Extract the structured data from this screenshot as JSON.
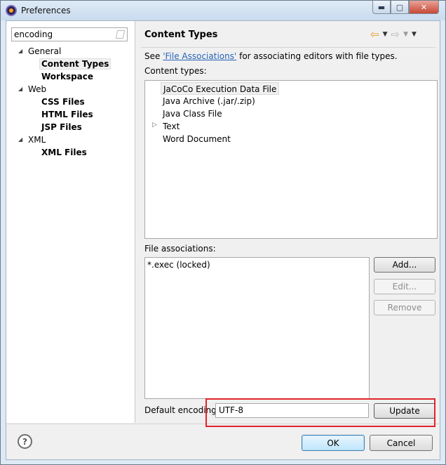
{
  "window": {
    "title": "Preferences",
    "minimize_glyph": "▬",
    "maximize_glyph": "▢",
    "close_glyph": "✕"
  },
  "filter": {
    "value": "encoding",
    "icon": "clear-filter-icon"
  },
  "tree": [
    {
      "label": "General",
      "expanded": true,
      "bold": false,
      "children": [
        {
          "label": "Content Types",
          "bold": true,
          "selected": true
        },
        {
          "label": "Workspace",
          "bold": true
        }
      ]
    },
    {
      "label": "Web",
      "expanded": true,
      "bold": false,
      "children": [
        {
          "label": "CSS Files",
          "bold": true
        },
        {
          "label": "HTML Files",
          "bold": true
        },
        {
          "label": "JSP Files",
          "bold": true
        }
      ]
    },
    {
      "label": "XML",
      "expanded": true,
      "bold": false,
      "children": [
        {
          "label": "XML Files",
          "bold": true
        }
      ]
    }
  ],
  "page": {
    "title": "Content Types",
    "see_prefix": "See ",
    "see_link": "'File Associations'",
    "see_suffix": " for associating editors with file types.",
    "content_types_label": "Content types:",
    "content_types": [
      {
        "label": "JaCoCo Execution Data File",
        "selected": true
      },
      {
        "label": "Java Archive (.jar/.zip)"
      },
      {
        "label": "Java Class File"
      },
      {
        "label": "Text",
        "expandable": true
      },
      {
        "label": "Word Document"
      }
    ],
    "file_associations_label": "File associations:",
    "file_associations": [
      "*.exec (locked)"
    ],
    "buttons": {
      "add": "Add...",
      "edit": "Edit...",
      "remove": "Remove"
    },
    "default_encoding_label": "Default encoding:",
    "default_encoding_value": "UTF-8",
    "update_button": "Update"
  },
  "footer": {
    "ok": "OK",
    "cancel": "Cancel",
    "help_glyph": "?"
  },
  "colors": {
    "link": "#2563b7",
    "highlight_border": "#e3232c"
  }
}
